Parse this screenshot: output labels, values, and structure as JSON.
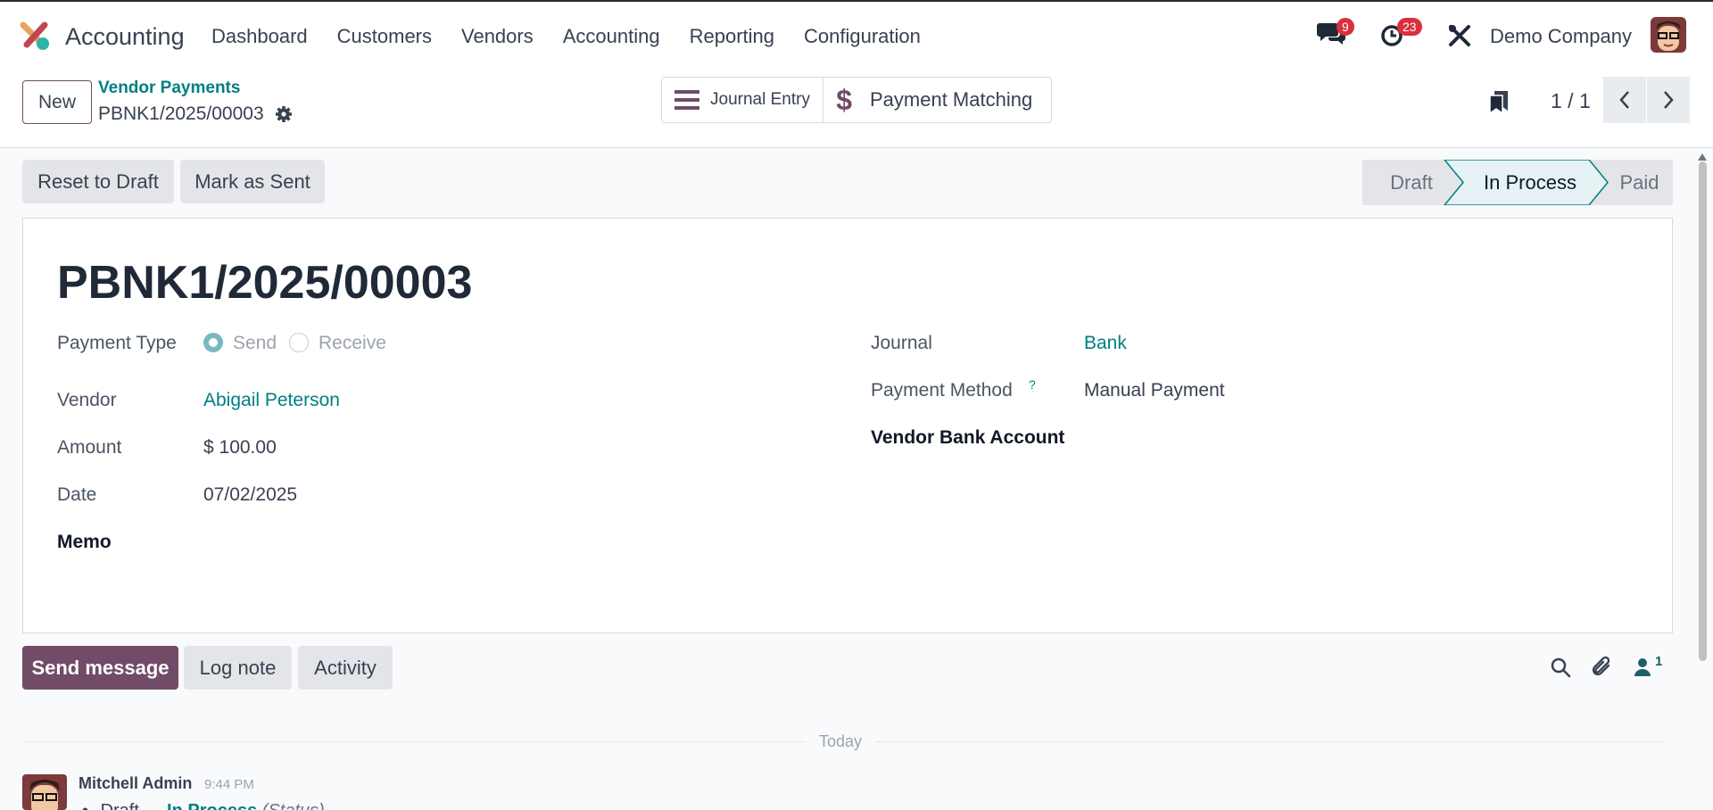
{
  "app": {
    "name": "Accounting"
  },
  "menu": [
    "Dashboard",
    "Customers",
    "Vendors",
    "Accounting",
    "Reporting",
    "Configuration"
  ],
  "systray": {
    "messages_count": "9",
    "activities_count": "23",
    "company": "Demo Company"
  },
  "control": {
    "new_label": "New",
    "breadcrumb_parent": "Vendor Payments",
    "breadcrumb_current": "PBNK1/2025/00003",
    "smart_buttons": {
      "journal_entry": "Journal Entry",
      "payment_matching": "Payment Matching"
    },
    "pager": "1 / 1"
  },
  "actions": {
    "reset_to_draft": "Reset to Draft",
    "mark_as_sent": "Mark as Sent"
  },
  "status": {
    "stages": [
      "Draft",
      "In Process",
      "Paid"
    ],
    "current": "In Process"
  },
  "form": {
    "title": "PBNK1/2025/00003",
    "payment_type_label": "Payment Type",
    "payment_type_options": [
      "Send",
      "Receive"
    ],
    "payment_type_selected": "Send",
    "vendor_label": "Vendor",
    "vendor": "Abigail Peterson",
    "amount_label": "Amount",
    "amount": "$ 100.00",
    "date_label": "Date",
    "date": "07/02/2025",
    "memo_label": "Memo",
    "journal_label": "Journal",
    "journal": "Bank",
    "payment_method_label": "Payment Method",
    "payment_method_help": "?",
    "payment_method": "Manual Payment",
    "vendor_bank_account_label": "Vendor Bank Account"
  },
  "chatter": {
    "send_message": "Send message",
    "log_note": "Log note",
    "activity": "Activity",
    "followers_count": "1",
    "separator": "Today",
    "message": {
      "author": "Mitchell Admin",
      "time": "9:44 PM",
      "from": "Draft",
      "arrow": "→",
      "to": "In Process",
      "field": "(Status)"
    }
  },
  "colors": {
    "brand": "#714b67",
    "link": "#017e84",
    "badge": "#d9303e"
  }
}
